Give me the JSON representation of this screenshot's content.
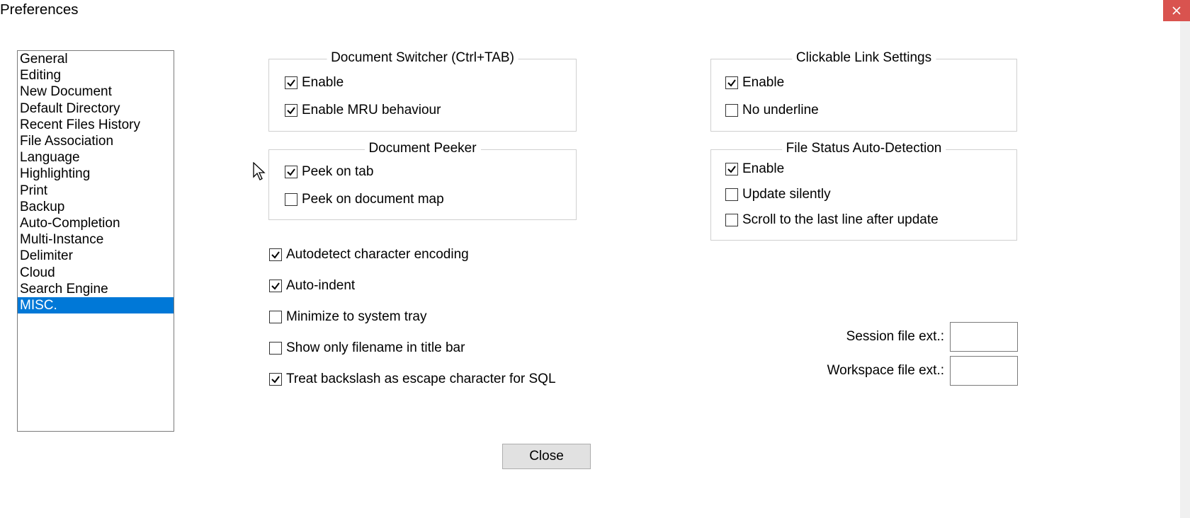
{
  "title": "Preferences",
  "close_x": "×",
  "categories": [
    "General",
    "Editing",
    "New Document",
    "Default Directory",
    "Recent Files History",
    "File Association",
    "Language",
    "Highlighting",
    "Print",
    "Backup",
    "Auto-Completion",
    "Multi-Instance",
    "Delimiter",
    "Cloud",
    "Search Engine",
    "MISC."
  ],
  "selected_category_index": 15,
  "group_doc_switcher": {
    "legend": "Document Switcher (Ctrl+TAB)",
    "enable": {
      "label": "Enable",
      "checked": true
    },
    "mru": {
      "label": "Enable MRU behaviour",
      "checked": true
    }
  },
  "group_doc_peeker": {
    "legend": "Document Peeker",
    "peek_tab": {
      "label": "Peek on tab",
      "checked": true
    },
    "peek_map": {
      "label": "Peek on document map",
      "checked": false
    }
  },
  "group_link": {
    "legend": "Clickable Link Settings",
    "enable": {
      "label": "Enable",
      "checked": true
    },
    "no_underline": {
      "label": "No underline",
      "checked": false
    }
  },
  "group_file_status": {
    "legend": "File Status Auto-Detection",
    "enable": {
      "label": "Enable",
      "checked": true
    },
    "silent": {
      "label": "Update silently",
      "checked": false
    },
    "scroll": {
      "label": "Scroll to the last line after update",
      "checked": false
    }
  },
  "misc_checks": {
    "autodetect": {
      "label": "Autodetect character encoding",
      "checked": true
    },
    "autoindent": {
      "label": "Auto-indent",
      "checked": true
    },
    "tray": {
      "label": "Minimize to system tray",
      "checked": false
    },
    "filename_only": {
      "label": "Show only filename in title bar",
      "checked": false
    },
    "backslash_sql": {
      "label": "Treat backslash as escape character for SQL",
      "checked": true
    }
  },
  "ext_fields": {
    "session": {
      "label": "Session file ext.:",
      "value": ""
    },
    "workspace": {
      "label": "Workspace file ext.:",
      "value": ""
    }
  },
  "close_button": "Close"
}
